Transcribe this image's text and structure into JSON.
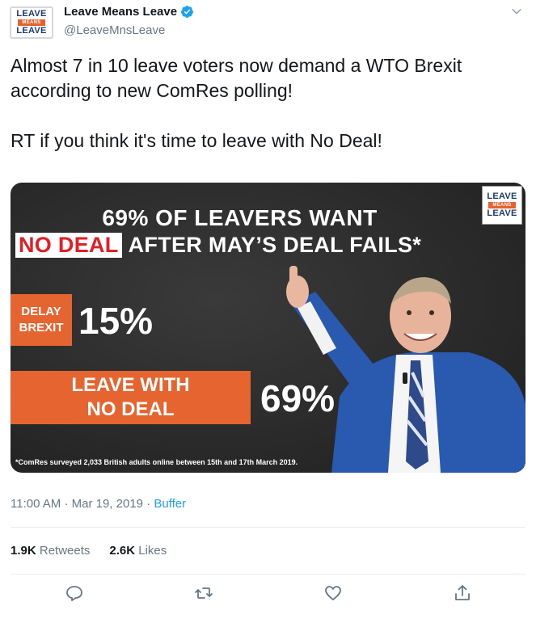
{
  "account": {
    "display_name": "Leave Means Leave",
    "handle": "@LeaveMnsLeave",
    "logo": [
      "LEAVE",
      "MEANS",
      "LEAVE"
    ]
  },
  "tweet": {
    "text": "Almost 7 in 10 leave voters now demand a WTO Brexit according to new ComRes polling!\n\nRT if you think it's time to leave with No Deal!"
  },
  "media": {
    "logo": [
      "LEAVE",
      "MEANS",
      "LEAVE"
    ],
    "headline_line1": "69% OF LEAVERS WANT",
    "headline_red": "NO DEAL",
    "headline_rest": "AFTER MAY’S DEAL FAILS*",
    "bar1_label": "DELAY\nBREXIT",
    "bar1_value": "15%",
    "bar2_label": "LEAVE WITH\nNO DEAL",
    "bar2_value": "69%",
    "footnote": "*ComRes surveyed 2,033 British adults online between 15th and 17th March 2019.",
    "accent_color": "#e6642f"
  },
  "meta": {
    "time": "11:00 AM",
    "date": "Mar 19, 2019",
    "separator": "·",
    "source": "Buffer"
  },
  "stats": {
    "retweets_count": "1.9K",
    "retweets_label": "Retweets",
    "likes_count": "2.6K",
    "likes_label": "Likes"
  },
  "actions": [
    "reply-icon",
    "retweet-icon",
    "like-icon",
    "share-icon"
  ]
}
